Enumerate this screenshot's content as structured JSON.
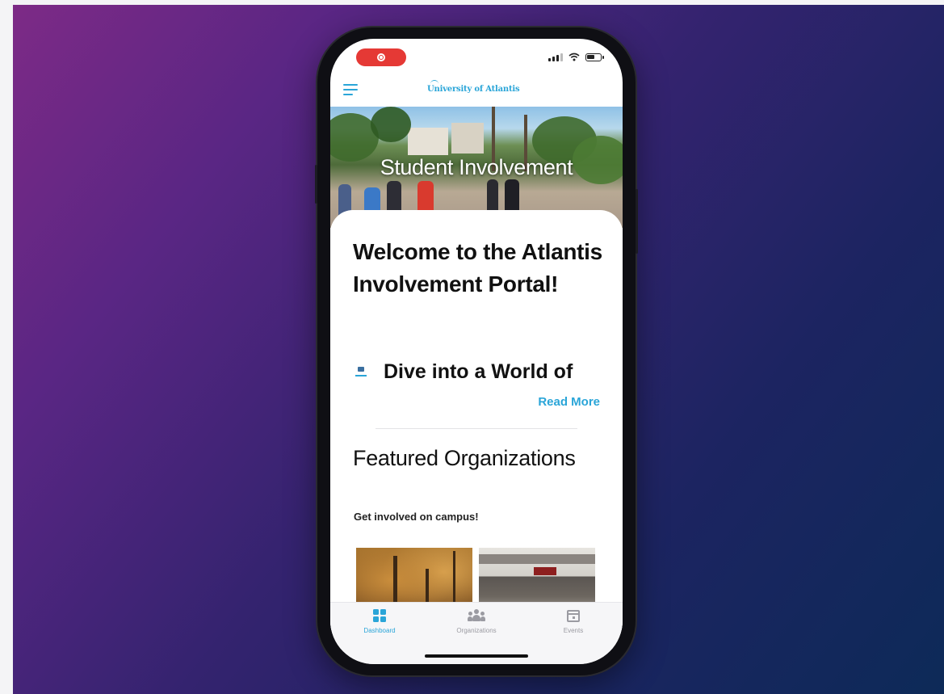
{
  "app": {
    "logo_text": "University of Atlantis",
    "brand_color": "#2aa5d8"
  },
  "status_bar": {
    "recording_indicator": "record-icon",
    "icons": [
      "cellular-signal-icon",
      "wifi-icon",
      "battery-icon"
    ]
  },
  "header": {
    "menu_icon": "hamburger-menu-icon"
  },
  "hero": {
    "title": "Student Involvement"
  },
  "welcome": {
    "heading": "Welcome to the Atlantis Involvement Portal!",
    "teaser_icon": "pennant-icon",
    "teaser_text": "Dive into a World of",
    "read_more_label": "Read More"
  },
  "featured": {
    "title": "Featured Organizations",
    "subtitle": "Get involved on campus!",
    "cards": [
      {
        "image": "autumn-trees-photo"
      },
      {
        "image": "campus-event-tents-photo"
      }
    ]
  },
  "tabbar": {
    "tabs": [
      {
        "label": "Dashboard",
        "icon": "dashboard-grid-icon",
        "active": true
      },
      {
        "label": "Organizations",
        "icon": "people-group-icon",
        "active": false
      },
      {
        "label": "Events",
        "icon": "calendar-icon",
        "active": false
      }
    ]
  }
}
